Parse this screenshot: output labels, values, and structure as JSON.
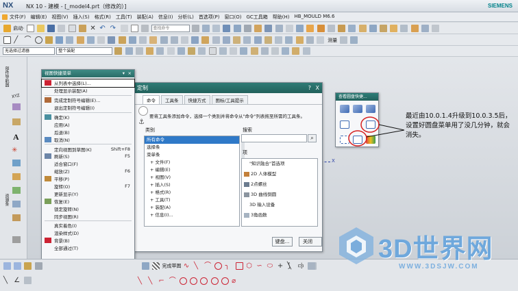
{
  "window": {
    "logo": "NX",
    "title": "NX 10 - 建模 - [_model4.prt（修改的）]",
    "brand": "SIEMENS"
  },
  "menubar": {
    "items": [
      "文件(F)",
      "编辑(E)",
      "视图(V)",
      "插入(S)",
      "格式(R)",
      "工具(T)",
      "装配(A)",
      "信息(I)",
      "分析(L)",
      "首选项(P)",
      "窗口(O)",
      "GC工具箱",
      "帮助(H)",
      "HB_MOULD M6.6"
    ]
  },
  "toolbar1": {
    "start_label": "启动·",
    "find_placeholder": "查找命令"
  },
  "toolbar3": {
    "filter_select": "无选择过滤器",
    "scope_select": "整个装配"
  },
  "toolbar2": {
    "measure_label": "测量"
  },
  "left_strip": {
    "labels": [
      "部件导航器",
      "XYZ",
      "资源条"
    ]
  },
  "shortcut_menu": {
    "title": "视图快捷菜单",
    "items": [
      {
        "label": "从列表中选择(L)...",
        "shortcut": "",
        "selected": true
      },
      {
        "label": "处理显示装配(A)",
        "shortcut": ""
      },
      {
        "sep": true
      },
      {
        "label": "完成定制符号编辑(E)...",
        "shortcut": ""
      },
      {
        "label": "退出定制符号编辑(I)",
        "shortcut": ""
      },
      {
        "sep": true
      },
      {
        "label": "确定(K)",
        "shortcut": ""
      },
      {
        "label": "应用(A)",
        "shortcut": ""
      },
      {
        "label": "后退(B)",
        "shortcut": ""
      },
      {
        "label": "取消(N)",
        "shortcut": ""
      },
      {
        "sep": true
      },
      {
        "label": "定向视图到草图(K)",
        "shortcut": "Shift+F8"
      },
      {
        "label": "刷新(S)",
        "shortcut": "F5"
      },
      {
        "label": "适合窗口(F)",
        "shortcut": ""
      },
      {
        "label": "缩放(Z)",
        "shortcut": "F6"
      },
      {
        "label": "平移(P)",
        "shortcut": ""
      },
      {
        "label": "旋转(O)",
        "shortcut": "F7"
      },
      {
        "label": "更新显示(Y)",
        "shortcut": ""
      },
      {
        "label": "恢复(E)",
        "shortcut": ""
      },
      {
        "label": "锁定旋转(N)",
        "shortcut": ""
      },
      {
        "label": "同步视图(R)",
        "shortcut": ""
      },
      {
        "sep": true
      },
      {
        "label": "真实着色(I)",
        "shortcut": ""
      },
      {
        "label": "渲染样式(D)",
        "shortcut": ""
      },
      {
        "label": "背景(B)",
        "shortcut": ""
      },
      {
        "label": "全部通过(T)",
        "shortcut": ""
      }
    ]
  },
  "customize_dialog": {
    "title": "定制",
    "help": "?",
    "close": "X",
    "tabs": [
      "命令",
      "工具条",
      "快捷方式",
      "图标/工具提示"
    ],
    "hint": "要将工具条添加命令，选择一个类别并将命令从\"命令\"列表拖至所需的工具条。",
    "category_label": "类别",
    "categories": [
      "所有命令",
      "选择条",
      "菜单条",
      "文件(F)",
      "编辑(E)",
      "视图(V)",
      "插入(S)",
      "格式(R)",
      "工具(T)",
      "装配(A)",
      "信息(I)..."
    ],
    "search_label": "搜索",
    "items_label": "项",
    "items": [
      "\"知识融合\"首选项",
      "2D 人体模型",
      "2点螺丝",
      "3D 曲线倒圆",
      "3D 输入设备",
      "3角函数"
    ],
    "keyboard_button": "键盘...",
    "close_button": "关闭"
  },
  "radial_toolbar": {
    "title": "查看圆盘快捷..."
  },
  "annotation": {
    "text": "最近由10.0.1.4升级到10.0.3.5后，设置好圆盘菜单用了没几分钟，就会消失。"
  },
  "axis_label": "X",
  "bottom_toolbar": {
    "finish_sketch": "完成草图"
  },
  "watermark": {
    "title": "3D世界网",
    "url": "WWW.3DSJW.COM"
  },
  "colors": {
    "dialog_header": "#2a6d68",
    "selection": "#2f79c8",
    "annotation_circle": "#d62020",
    "watermark": "#6fa8dc"
  }
}
